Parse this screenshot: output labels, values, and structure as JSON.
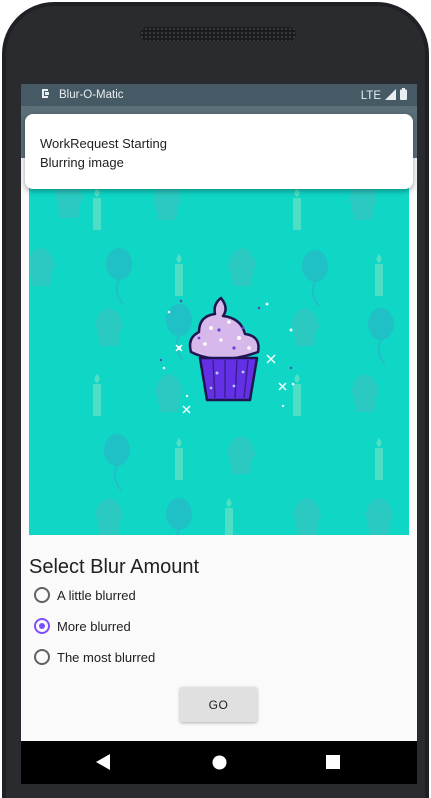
{
  "status_bar": {
    "app_name": "Blur-O-Matic",
    "network": "LTE",
    "icons": [
      "notification-icon",
      "signal-icon",
      "battery-icon"
    ]
  },
  "notification": {
    "line1": "WorkRequest Starting",
    "line2": "Blurring image"
  },
  "main": {
    "image": {
      "subject": "cupcake",
      "background_color": "#10d6c6"
    },
    "heading": "Select Blur Amount",
    "options": [
      {
        "label": "A little blurred",
        "checked": false
      },
      {
        "label": "More blurred",
        "checked": true
      },
      {
        "label": "The most blurred",
        "checked": false
      }
    ],
    "go_label": "GO"
  },
  "nav_bar": {
    "icons": [
      "back-icon",
      "home-icon",
      "recents-icon"
    ]
  },
  "colors": {
    "accent": "#7c4dff",
    "status_bar": "#455a64",
    "app_bar": "#5b6f79"
  }
}
